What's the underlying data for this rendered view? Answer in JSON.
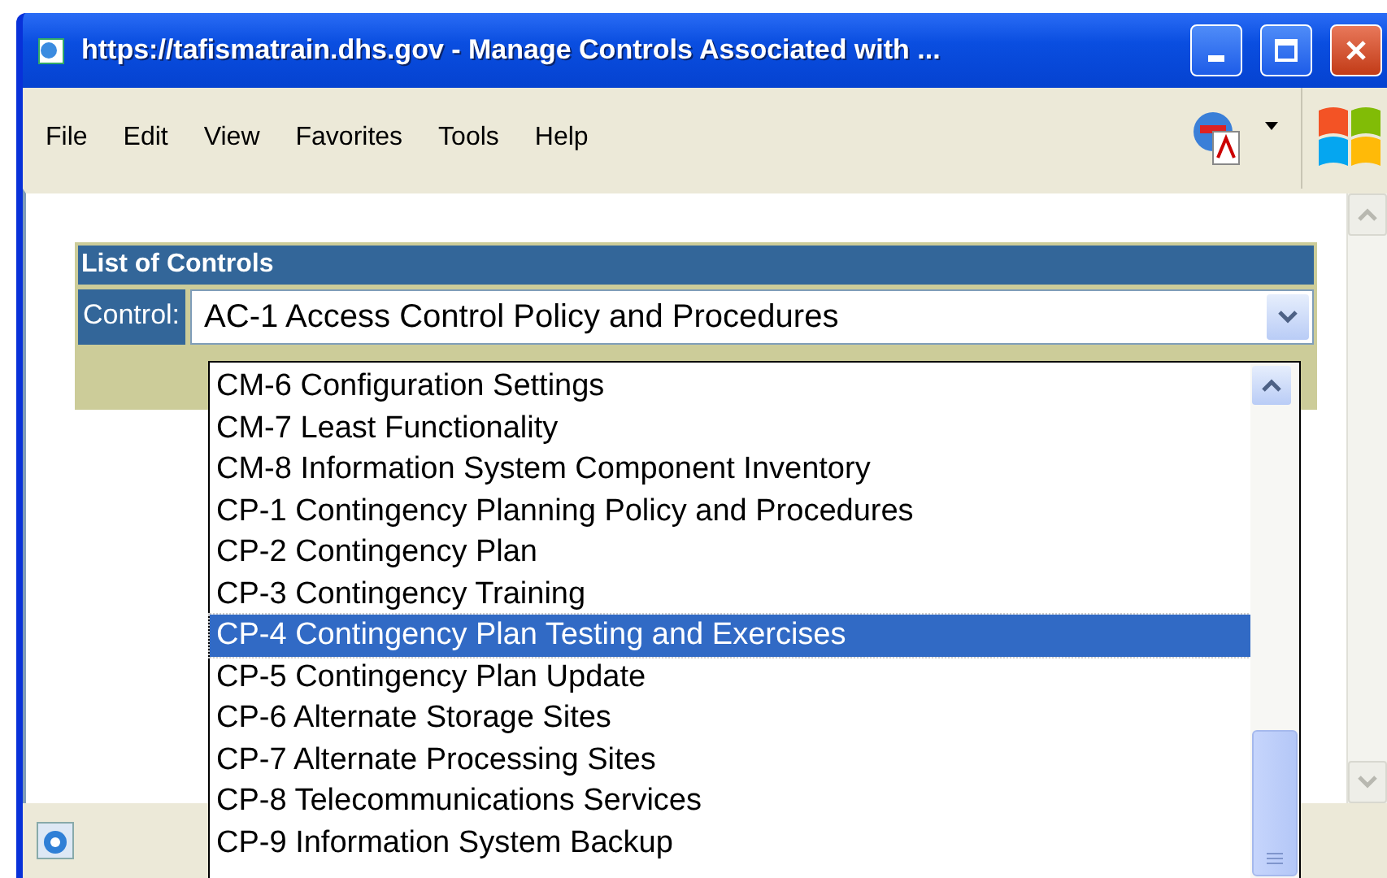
{
  "window": {
    "title": "https://tafismatrain.dhs.gov - Manage Controls Associated with ..."
  },
  "menu": [
    {
      "label": "File"
    },
    {
      "label": "Edit"
    },
    {
      "label": "View"
    },
    {
      "label": "Favorites"
    },
    {
      "label": "Tools"
    },
    {
      "label": "Help"
    }
  ],
  "panel": {
    "title": "List of Controls",
    "field_label": "Control:",
    "value": "AC-1 Access Control Policy and Procedures"
  },
  "dropdown": {
    "options": [
      {
        "label": "CM-6 Configuration Settings",
        "selected": false
      },
      {
        "label": "CM-7 Least Functionality",
        "selected": false
      },
      {
        "label": "CM-8 Information System Component Inventory",
        "selected": false
      },
      {
        "label": "CP-1 Contingency Planning Policy and Procedures",
        "selected": false
      },
      {
        "label": "CP-2 Contingency Plan",
        "selected": false
      },
      {
        "label": "CP-3 Contingency Training",
        "selected": false
      },
      {
        "label": "CP-4 Contingency Plan Testing and Exercises",
        "selected": true
      },
      {
        "label": "CP-5 Contingency Plan Update",
        "selected": false
      },
      {
        "label": "CP-6 Alternate Storage Sites",
        "selected": false
      },
      {
        "label": "CP-7 Alternate Processing Sites",
        "selected": false
      },
      {
        "label": "CP-8 Telecommunications Services",
        "selected": false
      },
      {
        "label": "CP-9 Information System Backup",
        "selected": false
      }
    ]
  }
}
